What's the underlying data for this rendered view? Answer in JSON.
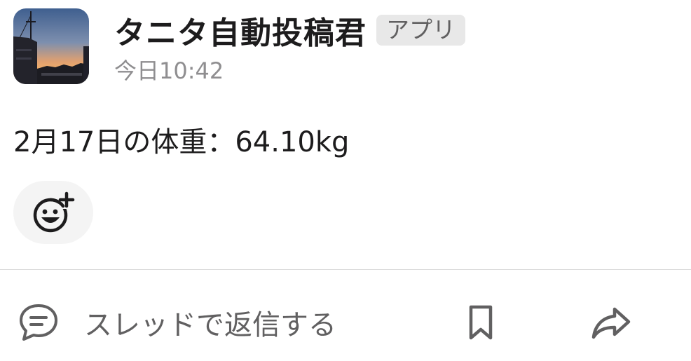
{
  "message": {
    "sender_name": "タニタ自動投稿君",
    "app_badge": "アプリ",
    "timestamp": "今日10:42",
    "text": "2月17日の体重：64.10kg",
    "avatar_icon": "sunset-photo-avatar"
  },
  "reaction": {
    "icon": "add-reaction-icon"
  },
  "actions": {
    "reply_label": "スレッドで返信する",
    "reply_icon": "comment-icon",
    "bookmark_icon": "bookmark-icon",
    "share_icon": "share-arrow-icon"
  }
}
